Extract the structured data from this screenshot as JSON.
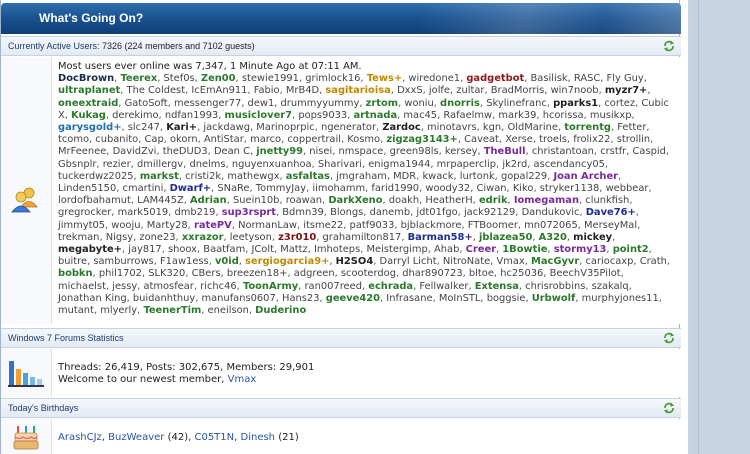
{
  "header": {
    "title": "What's Going On?"
  },
  "active": {
    "heading_label": "Currently Active Users",
    "heading_sub": ": 7326 (224 members and 7102 guests)",
    "most_ever": "Most users ever online was 7,347, 1 Minute Ago at 07:11 AM.",
    "users": [
      [
        "DocBrown",
        "b"
      ],
      [
        "Teerex",
        "g"
      ],
      [
        "Stef0s",
        "n0"
      ],
      [
        "Zen00",
        "g"
      ],
      [
        "stewie1991",
        "n0"
      ],
      [
        "grimlock16",
        "n0"
      ],
      [
        "Tews+",
        "o"
      ],
      [
        "wiredone1",
        "n0"
      ],
      [
        "gadgetbot",
        "r"
      ],
      [
        "Basilisk",
        "n0"
      ],
      [
        "RASC",
        "n0"
      ],
      [
        "Fly Guy",
        "n0"
      ],
      [
        "ultraplanet",
        "g"
      ],
      [
        "The Coldest",
        "n0"
      ],
      [
        "IcEmAn911",
        "n0"
      ],
      [
        "Fabio",
        "n0"
      ],
      [
        "MrB4D",
        "n0"
      ],
      [
        "sagitarioisa",
        "o"
      ],
      [
        "DxxS",
        "n0"
      ],
      [
        "jolfe",
        "n0"
      ],
      [
        "zultar",
        "n0"
      ],
      [
        "BradMorris",
        "n0"
      ],
      [
        "win7noob",
        "n0"
      ],
      [
        "myzr7+",
        "d"
      ],
      [
        "oneextraid",
        "g"
      ],
      [
        "GatoSoft",
        "n0"
      ],
      [
        "messenger77",
        "n0"
      ],
      [
        "dew1",
        "n0"
      ],
      [
        "drummyyummy",
        "n0"
      ],
      [
        "zrtom",
        "g"
      ],
      [
        "woniu",
        "n0"
      ],
      [
        "dnorris",
        "g"
      ],
      [
        "Skylinefranc",
        "n0"
      ],
      [
        "pparks1",
        "d"
      ],
      [
        "cortez",
        "n0"
      ],
      [
        "Cubic X",
        "n0"
      ],
      [
        "Kukag",
        "g"
      ],
      [
        "derekimo",
        "n0"
      ],
      [
        "ndfan1993",
        "n0"
      ],
      [
        "musiclover7",
        "g"
      ],
      [
        "pops9033",
        "n0"
      ],
      [
        "artnada",
        "g"
      ],
      [
        "mac45",
        "n0"
      ],
      [
        "Rafaelmw",
        "n0"
      ],
      [
        "mark39",
        "n0"
      ],
      [
        "hcorissa",
        "n0"
      ],
      [
        "musikxp",
        "n0"
      ],
      [
        "garysgold+",
        "t"
      ],
      [
        "slc247",
        "n0"
      ],
      [
        "Kari+",
        "d"
      ],
      [
        "jackdawg",
        "n0"
      ],
      [
        "Marinoprpic",
        "n0"
      ],
      [
        "ngenerator",
        "n0"
      ],
      [
        "Zardoc",
        "d"
      ],
      [
        "minotavrs",
        "n0"
      ],
      [
        "kgn",
        "n0"
      ],
      [
        "OldMarine",
        "n0"
      ],
      [
        "torrentg",
        "g"
      ],
      [
        "Fetter",
        "n0"
      ],
      [
        "tcomo",
        "n0"
      ],
      [
        "cubanito",
        "n0"
      ],
      [
        "Cap",
        "n0"
      ],
      [
        "okorn",
        "n0"
      ],
      [
        "AntiStar",
        "n0"
      ],
      [
        "marco",
        "n0"
      ],
      [
        "coppertrail",
        "n0"
      ],
      [
        "Kosmo",
        "n0"
      ],
      [
        "zigzag3143+",
        "g"
      ],
      [
        "Caveat",
        "n0"
      ],
      [
        "Xerse",
        "n0"
      ],
      [
        "troels",
        "n0"
      ],
      [
        "frolix22",
        "n0"
      ],
      [
        "strollin",
        "n0"
      ],
      [
        "MrFeenee",
        "n0"
      ],
      [
        "DavidZvi",
        "n0"
      ],
      [
        "theDUD3",
        "n0"
      ],
      [
        "Dean C",
        "n0"
      ],
      [
        "jnetty99",
        "g"
      ],
      [
        "nisei",
        "n0"
      ],
      [
        "nmspace",
        "n0"
      ],
      [
        "green98ls",
        "n0"
      ],
      [
        "kersey",
        "n0"
      ],
      [
        "TheBull",
        "p"
      ],
      [
        "christantoan",
        "n0"
      ],
      [
        "crstfr",
        "n0"
      ],
      [
        "Caspid",
        "n0"
      ],
      [
        "Gbsnplr",
        "n0"
      ],
      [
        "rezier",
        "n0"
      ],
      [
        "dmillergv",
        "n0"
      ],
      [
        "dnelms",
        "n0"
      ],
      [
        "nguyenxuanhoa",
        "n0"
      ],
      [
        "Sharivari",
        "n0"
      ],
      [
        "enigma1944",
        "n0"
      ],
      [
        "mrpaperclip",
        "n0"
      ],
      [
        "jk2rd",
        "n0"
      ],
      [
        "ascendancy05",
        "n0"
      ],
      [
        "tuckerdwz2025",
        "n0"
      ],
      [
        "markst",
        "g"
      ],
      [
        "cristi2k",
        "n0"
      ],
      [
        "mathewgx",
        "n0"
      ],
      [
        "asfaltas",
        "g"
      ],
      [
        "jmgraham",
        "n0"
      ],
      [
        "MDR",
        "n0"
      ],
      [
        "kwack",
        "n0"
      ],
      [
        "lurtonk",
        "n0"
      ],
      [
        "gopal229",
        "n0"
      ],
      [
        "Joan Archer",
        "p"
      ],
      [
        "Linden5150",
        "n0"
      ],
      [
        "cmartini",
        "n0"
      ],
      [
        "Dwarf+",
        "n"
      ],
      [
        "SNaRe",
        "n0"
      ],
      [
        "TommyJay",
        "n0"
      ],
      [
        "iimohamm",
        "n0"
      ],
      [
        "farid1990",
        "n0"
      ],
      [
        "woody32",
        "n0"
      ],
      [
        "Ciwan",
        "n0"
      ],
      [
        "Kiko",
        "n0"
      ],
      [
        "stryker1138",
        "n0"
      ],
      [
        "webbear",
        "n0"
      ],
      [
        "lordofbahamut",
        "n0"
      ],
      [
        "LAM445Z",
        "n0"
      ],
      [
        "Adrian",
        "g"
      ],
      [
        "Suein10b",
        "n0"
      ],
      [
        "roawan",
        "n0"
      ],
      [
        "DarkXeno",
        "g"
      ],
      [
        "doakh",
        "n0"
      ],
      [
        "HeatherH",
        "n0"
      ],
      [
        "edrik",
        "g"
      ],
      [
        "Iomegaman",
        "p"
      ],
      [
        "clunkfish",
        "n0"
      ],
      [
        "gregrocker",
        "n0"
      ],
      [
        "mark5019",
        "n0"
      ],
      [
        "dmb219",
        "n0"
      ],
      [
        "sup3rsprt",
        "p"
      ],
      [
        "Bdmn39",
        "n0"
      ],
      [
        "Blongs",
        "n0"
      ],
      [
        "danemb",
        "n0"
      ],
      [
        "jdt01fgo",
        "n0"
      ],
      [
        "jack92129",
        "n0"
      ],
      [
        "Dandukovic",
        "n0"
      ],
      [
        "Dave76+",
        "n"
      ],
      [
        "jimmyt05",
        "n0"
      ],
      [
        "wooju",
        "n0"
      ],
      [
        "Marty28",
        "n0"
      ],
      [
        "ratePV",
        "p"
      ],
      [
        "NormanLaw",
        "n0"
      ],
      [
        "itsme22",
        "n0"
      ],
      [
        "patf9033",
        "n0"
      ],
      [
        "bjblackmore",
        "n0"
      ],
      [
        "FTBoomer",
        "n0"
      ],
      [
        "mn072065",
        "n0"
      ],
      [
        "MerseyMal",
        "n0"
      ],
      [
        "trekman",
        "n0"
      ],
      [
        "Nigsy",
        "n0"
      ],
      [
        "zone23",
        "n0"
      ],
      [
        "xxrazor",
        "g"
      ],
      [
        "leetyson",
        "n0"
      ],
      [
        "z3r010",
        "m"
      ],
      [
        "grahamilton817",
        "n0"
      ],
      [
        "Barman58+",
        "n"
      ],
      [
        "jblazea50",
        "g"
      ],
      [
        "A320",
        "g"
      ],
      [
        "mickey",
        "d"
      ],
      [
        "megabyte+",
        "d"
      ],
      [
        "jay817",
        "n0"
      ],
      [
        "shoox",
        "n0"
      ],
      [
        "Baatfam",
        "n0"
      ],
      [
        "JColt",
        "n0"
      ],
      [
        "Mattz",
        "n0"
      ],
      [
        "Imhoteps",
        "n0"
      ],
      [
        "Meistergimp",
        "n0"
      ],
      [
        "Ahab",
        "n0"
      ],
      [
        "Creer",
        "p"
      ],
      [
        "1Bowtie",
        "g"
      ],
      [
        "stormy13",
        "p"
      ],
      [
        "point2",
        "g"
      ],
      [
        "buitre",
        "n0"
      ],
      [
        "samburrows",
        "n0"
      ],
      [
        "F1aw1ess",
        "n0"
      ],
      [
        "v0id",
        "g"
      ],
      [
        "sergiogarcia9+",
        "o"
      ],
      [
        "H2SO4",
        "d"
      ],
      [
        "Darryl Licht",
        "n0"
      ],
      [
        "NitroNate",
        "n0"
      ],
      [
        "Vmax",
        "n0"
      ],
      [
        "MacGyvr",
        "g"
      ],
      [
        "cariocaxp",
        "n0"
      ],
      [
        "Crath",
        "n0"
      ],
      [
        "bobkn",
        "g"
      ],
      [
        "phil1702",
        "n0"
      ],
      [
        "SLK320",
        "n0"
      ],
      [
        "CBers",
        "n0"
      ],
      [
        "breezen18+",
        "n0"
      ],
      [
        "adgreen",
        "n0"
      ],
      [
        "scooterdog",
        "n0"
      ],
      [
        "dhar890723",
        "n0"
      ],
      [
        "bltoe",
        "n0"
      ],
      [
        "hc25036",
        "n0"
      ],
      [
        "BeechV35Pilot",
        "n0"
      ],
      [
        "michaelst",
        "n0"
      ],
      [
        "jessy",
        "n0"
      ],
      [
        "atmosfear",
        "n0"
      ],
      [
        "richc46",
        "n0"
      ],
      [
        "ToonArmy",
        "g"
      ],
      [
        "ran007reed",
        "n0"
      ],
      [
        "echrada",
        "g"
      ],
      [
        "Fellwalker",
        "n0"
      ],
      [
        "Extensa",
        "g"
      ],
      [
        "chrisrobbins",
        "n0"
      ],
      [
        "szakalq",
        "n0"
      ],
      [
        "Jonathan King",
        "n0"
      ],
      [
        "buidanhthuy",
        "n0"
      ],
      [
        "manufans0607",
        "n0"
      ],
      [
        "Hans23",
        "n0"
      ],
      [
        "geeve420",
        "g"
      ],
      [
        "Infrasane",
        "n0"
      ],
      [
        "MoInSTL",
        "n0"
      ],
      [
        "boggsie",
        "n0"
      ],
      [
        "Urbwolf",
        "g"
      ],
      [
        "murphyjones11",
        "n0"
      ],
      [
        "mutant",
        "n0"
      ],
      [
        "mlyerly",
        "n0"
      ],
      [
        "TeenerTim",
        "g"
      ],
      [
        "eneilson",
        "n0"
      ],
      [
        "Duderino",
        "g"
      ]
    ]
  },
  "stats": {
    "heading": "Windows 7 Forums Statistics",
    "line1": "Threads: 26,419, Posts: 302,675, Members: 29,901",
    "welcome": "Welcome to our newest member, ",
    "newest": "Vmax"
  },
  "birthdays": {
    "heading": "Today's Birthdays",
    "people": [
      {
        "name": "ArashCJz",
        "age": ""
      },
      {
        "name": "BuzWeaver",
        "age": "(42)"
      },
      {
        "name": "C05T1N",
        "age": ""
      },
      {
        "name": "Dinesh",
        "age": "(21)"
      }
    ]
  }
}
